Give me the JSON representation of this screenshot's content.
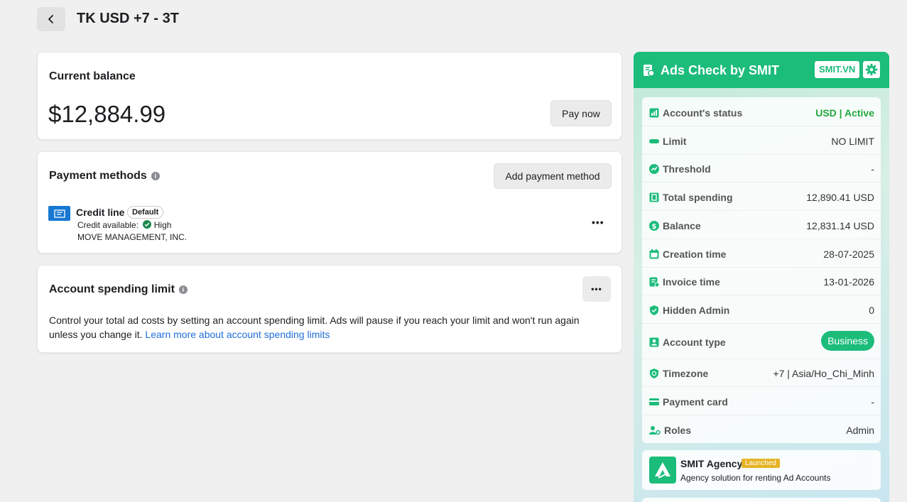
{
  "header": {
    "title": "TK USD +7 - 3T"
  },
  "balance": {
    "label": "Current balance",
    "amount": "$12,884.99",
    "pay_button": "Pay now"
  },
  "payment_methods": {
    "heading": "Payment methods",
    "add_button": "Add payment method",
    "method": {
      "name": "Credit line",
      "badge": "Default",
      "credit_label": "Credit available:",
      "credit_value": "High",
      "company": "MOVE MANAGEMENT, INC."
    }
  },
  "spending_limit": {
    "heading": "Account spending limit",
    "description": "Control your total ad costs by setting an account spending limit. Ads will pause if you reach your limit and won't run again unless you change it.",
    "link": "Learn more about account spending limits"
  },
  "ads_check": {
    "title": "Ads Check by SMIT",
    "site_badge": "SMIT.VN",
    "rows": [
      {
        "label": "Account's status",
        "value": "USD | Active",
        "icon": "chart-icon"
      },
      {
        "label": "Limit",
        "value": "NO LIMIT",
        "icon": "bar-icon"
      },
      {
        "label": "Threshold",
        "value": "-",
        "icon": "trend-icon"
      },
      {
        "label": "Total spending",
        "value": "12,890.41 USD",
        "icon": "wallet-icon"
      },
      {
        "label": "Balance",
        "value": "12,831.14 USD",
        "icon": "dollar-icon"
      },
      {
        "label": "Creation time",
        "value": "28-07-2025",
        "icon": "calendar-icon"
      },
      {
        "label": "Invoice time",
        "value": "13-01-2026",
        "icon": "invoice-icon"
      },
      {
        "label": "Hidden Admin",
        "value": "0",
        "icon": "shield-icon"
      },
      {
        "label": "Account type",
        "value": "Business",
        "icon": "user-icon"
      },
      {
        "label": "Timezone",
        "value": "+7 | Asia/Ho_Chi_Minh",
        "icon": "globe-shield-icon"
      },
      {
        "label": "Payment card",
        "value": "-",
        "icon": "card-icon"
      },
      {
        "label": "Roles",
        "value": "Admin",
        "icon": "users-gear-icon"
      }
    ],
    "agency": {
      "name": "SMIT Agency",
      "tag": "Launched",
      "description": "Agency solution for renting Ad Accounts"
    }
  },
  "colors": {
    "accent": "#1cbc7b",
    "active_text": "#22a83c",
    "link": "#216fdb"
  }
}
